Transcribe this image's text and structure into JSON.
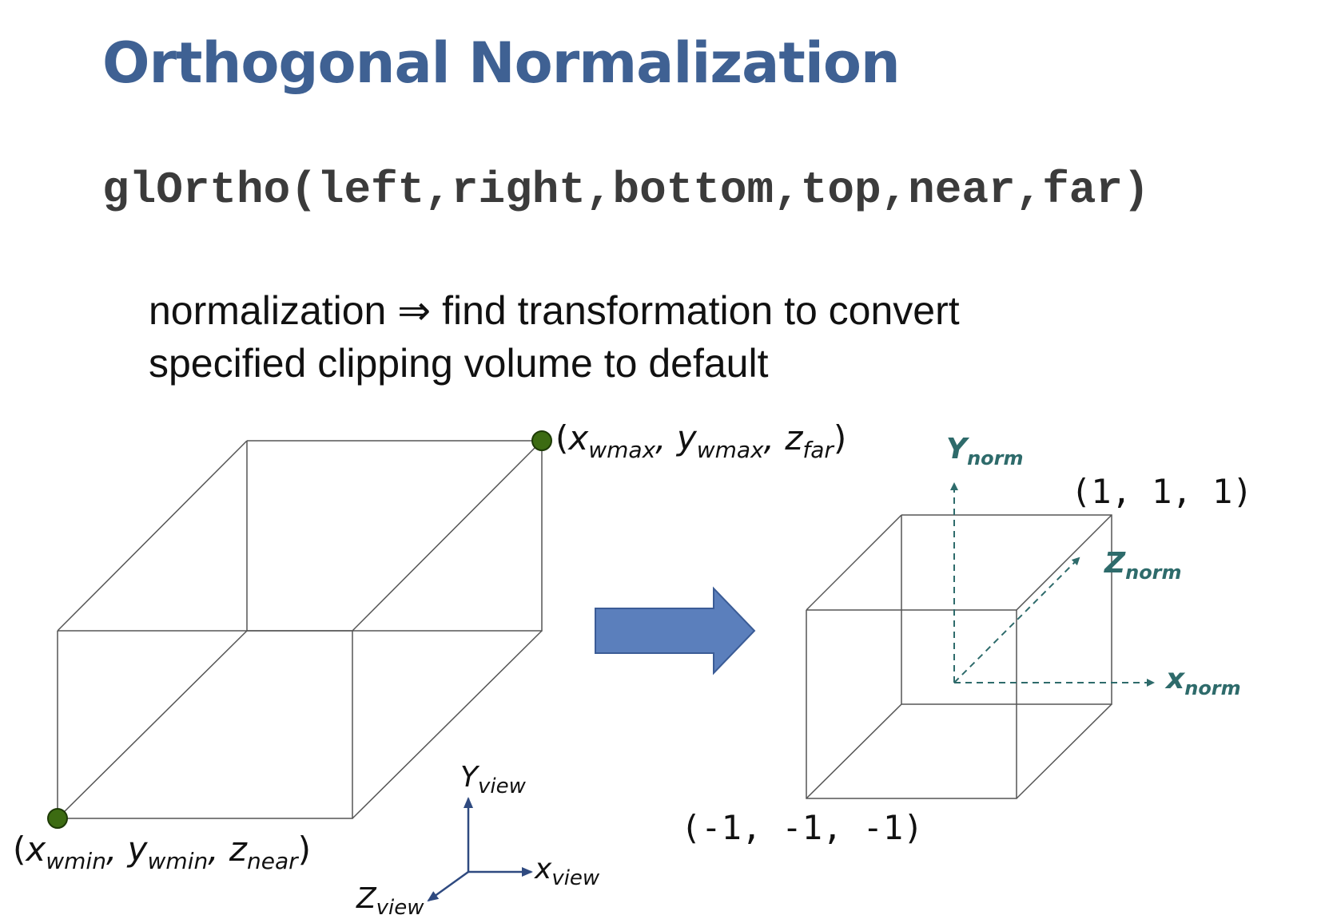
{
  "slide": {
    "title": "Orthogonal Normalization",
    "function_call": "glOrtho(left,right,bottom,top,near,far)",
    "description": {
      "lead": "normalization",
      "implies_symbol": "⇒",
      "line1_rest": "find transformation to convert",
      "line2": "specified clipping volume to default"
    }
  },
  "diagram": {
    "corner_max": {
      "open": "(",
      "x": "x",
      "x_sub": "wmax",
      "sep1": ", ",
      "y": "y",
      "y_sub": "wmax",
      "sep2": ", ",
      "z": "z",
      "z_sub": "far",
      "close": ")"
    },
    "corner_min": {
      "open": "(",
      "x": "x",
      "x_sub": "wmin",
      "sep1": ", ",
      "y": "y",
      "y_sub": "wmin",
      "sep2": ", ",
      "z": "z",
      "z_sub": "near",
      "close": ")"
    },
    "view_axes": {
      "y": "Y",
      "y_sub": "view",
      "x": "x",
      "x_sub": "view",
      "z": "Z",
      "z_sub": "view"
    },
    "norm_axes": {
      "y": "Y",
      "y_sub": "norm",
      "z": "Z",
      "z_sub": "norm",
      "x": "x",
      "x_sub": "norm"
    },
    "cube_max_label": "(1, 1, 1)",
    "cube_min_label": "(-1, -1, -1)",
    "colors": {
      "title": "#3f6193",
      "arrow_fill": "#5b7fbc",
      "arrow_stroke": "#3b5c96",
      "norm_axis": "#2e6b6b",
      "view_axis": "#2f4a80",
      "corner_point": "#3c6b12"
    }
  }
}
